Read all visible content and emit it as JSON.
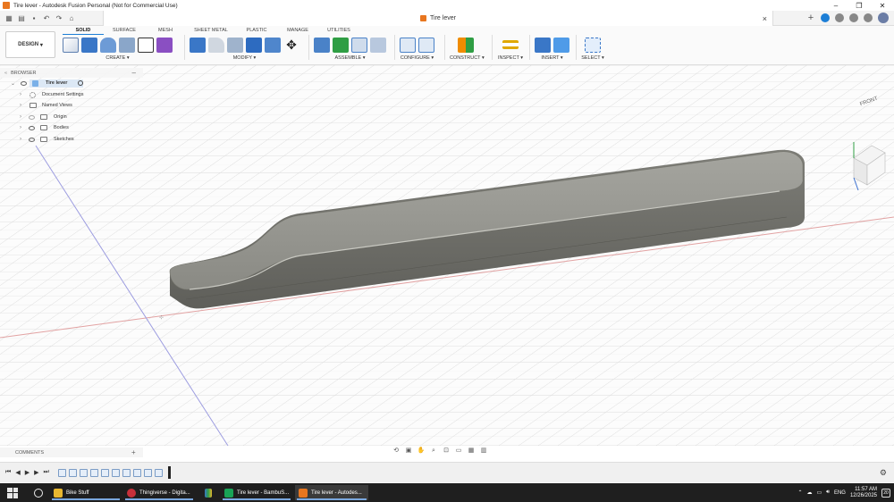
{
  "window": {
    "title": "Tire lever - Autodesk Fusion Personal (Not for Commercial Use)"
  },
  "document": {
    "tab_name": "Tire lever"
  },
  "workspace": {
    "design_button": "DESIGN",
    "tabs": [
      "SOLID",
      "SURFACE",
      "MESH",
      "SHEET METAL",
      "PLASTIC",
      "MANAGE",
      "UTILITIES"
    ],
    "active_tab": "SOLID"
  },
  "toolbar": {
    "create": "CREATE",
    "modify": "MODIFY",
    "assemble": "ASSEMBLE",
    "configure": "CONFIGURE",
    "construct": "CONSTRUCT",
    "inspect": "INSPECT",
    "insert": "INSERT",
    "select": "SELECT"
  },
  "browser": {
    "title": "BROWSER",
    "root": "Tire lever",
    "items": [
      {
        "label": "Document Settings",
        "icon": "gear-icon"
      },
      {
        "label": "Named Views",
        "icon": "folder-icon"
      },
      {
        "label": "Origin",
        "icon": "folder-icon"
      },
      {
        "label": "Bodies",
        "icon": "folder-icon"
      },
      {
        "label": "Sketches",
        "icon": "folder-icon"
      }
    ]
  },
  "viewcube": {
    "face": "FRONT"
  },
  "comments": {
    "label": "COMMENTS"
  },
  "taskbar": {
    "items": [
      {
        "label": "Bike Stuff",
        "color": "#e8b730"
      },
      {
        "label": "Thingiverse - Digita...",
        "color": "#c8303a"
      },
      {
        "label": "Tire lever - BambuS...",
        "color": "#19a356"
      },
      {
        "label": "Tire lever - Autodes...",
        "color": "#e8761f"
      }
    ],
    "language": "ENG",
    "time": "11:57 AM",
    "date": "12/26/2025",
    "notifications": "20"
  },
  "colors": {
    "accent": "#1c7ed6",
    "model": "#8d8d86",
    "brand": "#e8761f"
  }
}
